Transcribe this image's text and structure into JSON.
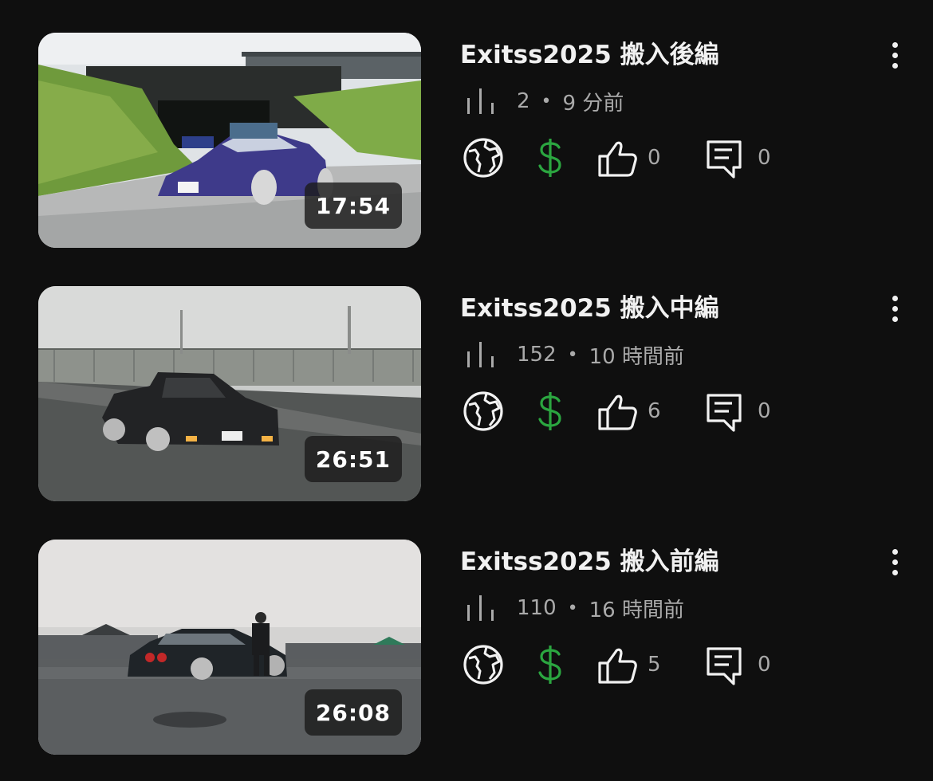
{
  "videos": [
    {
      "title": "Exitss2025 搬入後編",
      "views": "2",
      "time": "9 分前",
      "duration": "17:54",
      "likes": "0",
      "comments": "0",
      "thumbnail": "purple-car-tunnel"
    },
    {
      "title": "Exitss2025 搬入中編",
      "views": "152",
      "time": "10 時間前",
      "duration": "26:51",
      "likes": "6",
      "comments": "0",
      "thumbnail": "dark-car-fog"
    },
    {
      "title": "Exitss2025 搬入前編",
      "views": "110",
      "time": "16 時間前",
      "duration": "26:08",
      "likes": "5",
      "comments": "0",
      "thumbnail": "parking-lot-cars"
    }
  ],
  "separator": "•",
  "colors": {
    "background": "#0f0f0f",
    "text": "#f1f1f1",
    "secondary": "#aaaaaa",
    "monetization": "#2ba640"
  },
  "icons": {
    "views": "views-bar-icon",
    "visibility": "globe-icon",
    "monetization": "dollar-icon",
    "likes": "thumbs-up-icon",
    "comments": "comment-icon",
    "menu": "more-vert-icon"
  }
}
